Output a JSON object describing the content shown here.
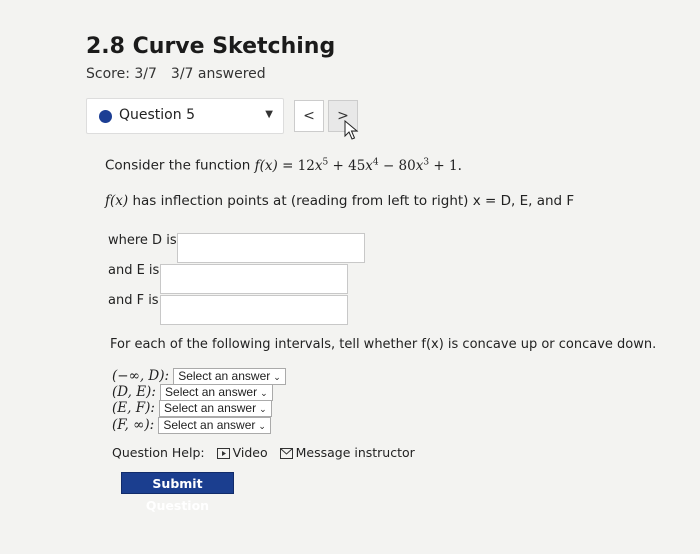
{
  "assignment": {
    "title": "2.8 Curve Sketching",
    "score": "Score: 3/7",
    "answered": "3/7 answered"
  },
  "question_nav": {
    "label": "Question 5",
    "prev": "<",
    "next": ">"
  },
  "question": {
    "intro": "Consider the function",
    "function_display": "f(x) = 12x5 + 45x4 − 80x3 + 1.",
    "inflection_text": "has inflection points at (reading from left to right) x = D, E, and F",
    "fx_label": "f(x)",
    "where_d": "where D is",
    "and_e": "and E is",
    "and_f": "and F is",
    "concavity_prompt": "For each of the following intervals, tell whether f(x) is concave up or concave down."
  },
  "intervals": [
    {
      "label": "(−∞, D):",
      "selected": "Select an answer"
    },
    {
      "label": "(D, E):",
      "selected": "Select an answer"
    },
    {
      "label": "(E, F):",
      "selected": "Select an answer"
    },
    {
      "label": "(F, ∞):",
      "selected": "Select an answer"
    }
  ],
  "help": {
    "label": "Question Help:",
    "video": "Video",
    "message": "Message instructor"
  },
  "submit_label": "Submit Question",
  "colors": {
    "accent": "#1b3e8f",
    "dot": "#1c3e94"
  }
}
